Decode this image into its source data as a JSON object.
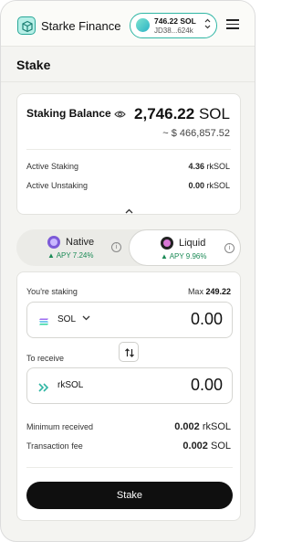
{
  "header": {
    "brand": "Starke Finance",
    "wallet": {
      "balance": "746.22 SOL",
      "address": "JD38...624k"
    }
  },
  "page": {
    "title": "Stake"
  },
  "balance_card": {
    "label": "Staking Balance",
    "value": "2,746.22",
    "unit": "SOL",
    "usd": "~ $ 466,857.52",
    "rows": [
      {
        "label": "Active Staking",
        "value": "4.36",
        "unit": "rkSOL"
      },
      {
        "label": "Active Unstaking",
        "value": "0.00",
        "unit": "rkSOL"
      }
    ]
  },
  "mode_toggle": {
    "native": {
      "label": "Native",
      "apy": "▲ APY 7.24%"
    },
    "liquid": {
      "label": "Liquid",
      "apy": "▲ APY 9.96%"
    },
    "selected": "liquid"
  },
  "stake_form": {
    "staking_label": "You're staking",
    "max_label": "Max",
    "max_value": "249.22",
    "from_token": "SOL",
    "from_amount": "0.00",
    "receive_label": "To receive",
    "to_token": "rkSOL",
    "to_amount": "0.00",
    "min_received_label": "Minimum received",
    "min_received_value": "0.002",
    "min_received_unit": "rkSOL",
    "fee_label": "Transaction fee",
    "fee_value": "0.002",
    "fee_unit": "SOL",
    "submit_label": "Stake"
  },
  "colors": {
    "accent": "#2fb6a4",
    "positive": "#1b8a56",
    "primary_button": "#0f0f0f"
  }
}
